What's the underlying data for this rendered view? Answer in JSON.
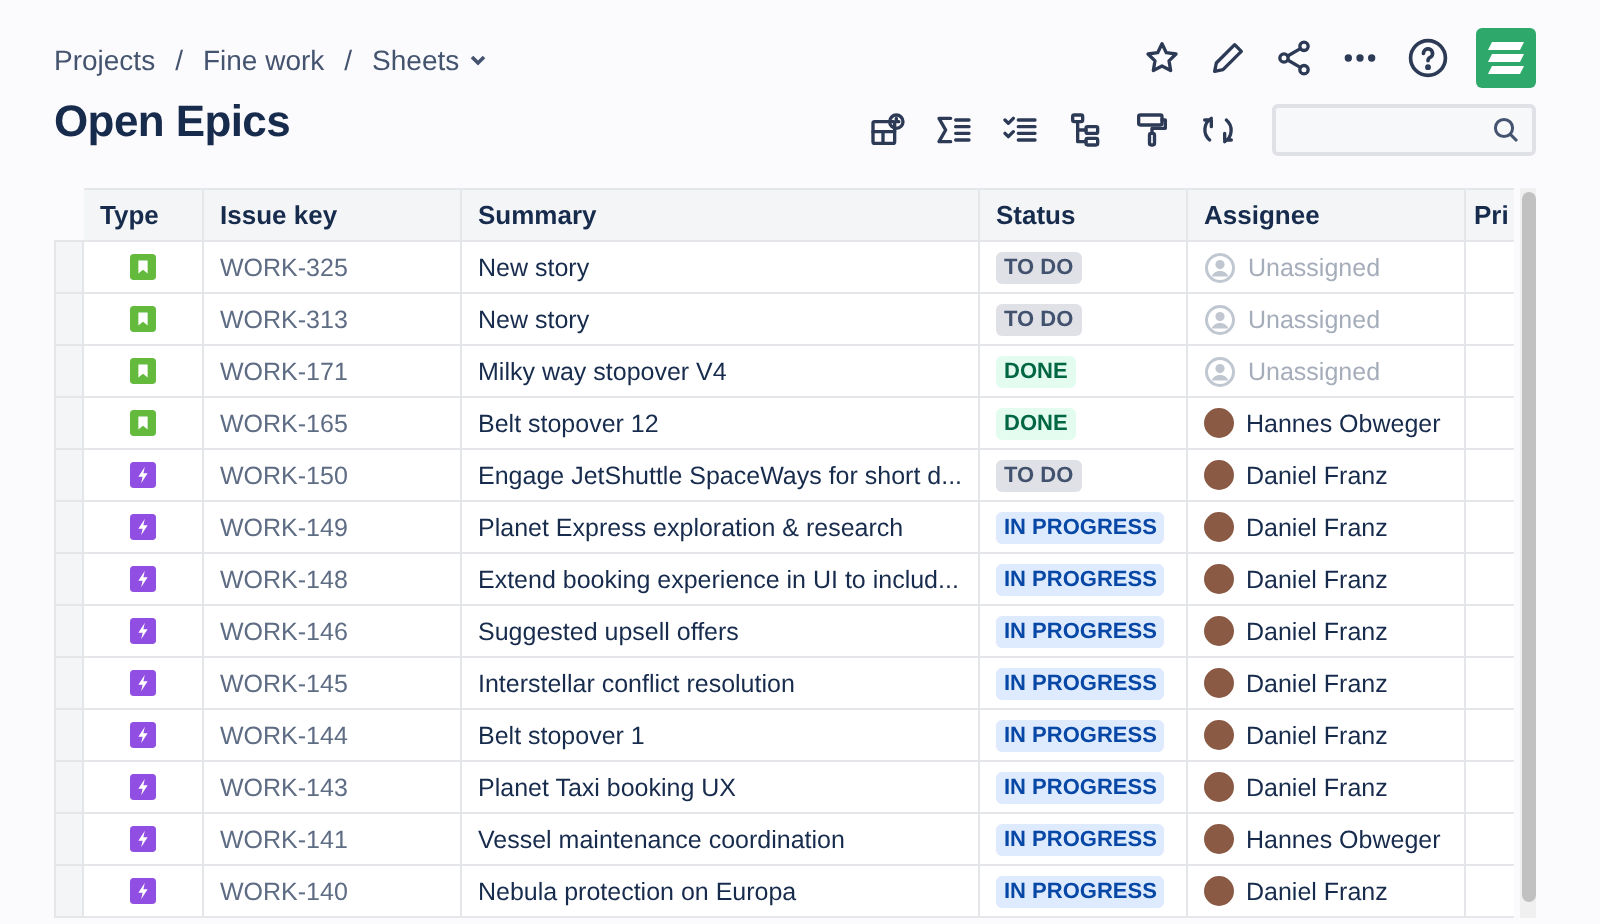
{
  "breadcrumbs": [
    {
      "label": "Projects"
    },
    {
      "label": "Fine work"
    },
    {
      "label": "Sheets",
      "dropdown": true
    }
  ],
  "separators": [
    "/",
    "/"
  ],
  "title": "Open Epics",
  "table": {
    "columns": [
      "Type",
      "Issue key",
      "Summary",
      "Status",
      "Assignee",
      "Pri"
    ],
    "rows": [
      {
        "kind": "story",
        "key": "WORK-325",
        "summary": "New story",
        "status": {
          "kind": "todo",
          "label": "TO DO"
        },
        "assignee": {
          "kind": "unassigned",
          "name": "Unassigned"
        }
      },
      {
        "kind": "story",
        "key": "WORK-313",
        "summary": "New story",
        "status": {
          "kind": "todo",
          "label": "TO DO"
        },
        "assignee": {
          "kind": "unassigned",
          "name": "Unassigned"
        }
      },
      {
        "kind": "story",
        "key": "WORK-171",
        "summary": "Milky way stopover V4",
        "status": {
          "kind": "done",
          "label": "DONE"
        },
        "assignee": {
          "kind": "unassigned",
          "name": "Unassigned"
        }
      },
      {
        "kind": "story",
        "key": "WORK-165",
        "summary": "Belt stopover 12",
        "status": {
          "kind": "done",
          "label": "DONE"
        },
        "assignee": {
          "kind": "person",
          "name": "Hannes Obweger"
        }
      },
      {
        "kind": "epic",
        "key": "WORK-150",
        "summary": "Engage JetShuttle SpaceWays for short d...",
        "status": {
          "kind": "todo",
          "label": "TO DO"
        },
        "assignee": {
          "kind": "person",
          "name": "Daniel Franz"
        }
      },
      {
        "kind": "epic",
        "key": "WORK-149",
        "summary": "Planet Express exploration & research",
        "status": {
          "kind": "inprogress",
          "label": "IN PROGRESS"
        },
        "assignee": {
          "kind": "person",
          "name": "Daniel Franz"
        }
      },
      {
        "kind": "epic",
        "key": "WORK-148",
        "summary": "Extend booking experience in UI to includ...",
        "status": {
          "kind": "inprogress",
          "label": "IN PROGRESS"
        },
        "assignee": {
          "kind": "person",
          "name": "Daniel Franz"
        }
      },
      {
        "kind": "epic",
        "key": "WORK-146",
        "summary": "Suggested upsell offers",
        "status": {
          "kind": "inprogress",
          "label": "IN PROGRESS"
        },
        "assignee": {
          "kind": "person",
          "name": "Daniel Franz"
        }
      },
      {
        "kind": "epic",
        "key": "WORK-145",
        "summary": "Interstellar conflict resolution",
        "status": {
          "kind": "inprogress",
          "label": "IN PROGRESS"
        },
        "assignee": {
          "kind": "person",
          "name": "Daniel Franz"
        }
      },
      {
        "kind": "epic",
        "key": "WORK-144",
        "summary": "Belt stopover 1",
        "status": {
          "kind": "inprogress",
          "label": "IN PROGRESS"
        },
        "assignee": {
          "kind": "person",
          "name": "Daniel Franz"
        }
      },
      {
        "kind": "epic",
        "key": "WORK-143",
        "summary": "Planet Taxi booking UX",
        "status": {
          "kind": "inprogress",
          "label": "IN PROGRESS"
        },
        "assignee": {
          "kind": "person",
          "name": "Daniel Franz"
        }
      },
      {
        "kind": "epic",
        "key": "WORK-141",
        "summary": "Vessel maintenance coordination",
        "status": {
          "kind": "inprogress",
          "label": "IN PROGRESS"
        },
        "assignee": {
          "kind": "person",
          "name": "Hannes Obweger"
        }
      },
      {
        "kind": "epic",
        "key": "WORK-140",
        "summary": "Nebula protection on Europa",
        "status": {
          "kind": "inprogress",
          "label": "IN PROGRESS"
        },
        "assignee": {
          "kind": "person",
          "name": "Daniel Franz"
        }
      }
    ]
  }
}
